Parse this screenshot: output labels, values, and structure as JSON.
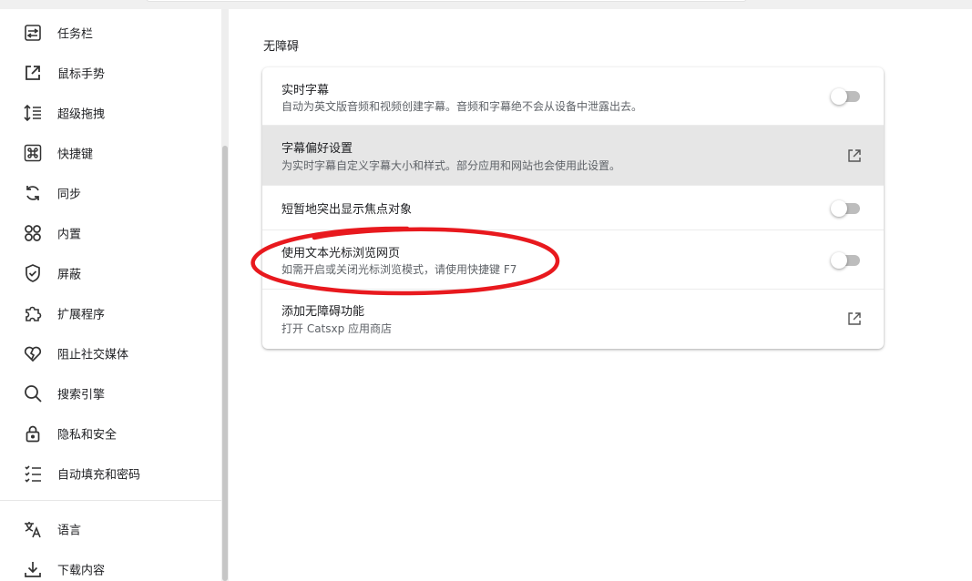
{
  "sidebar": {
    "items": [
      {
        "label": "任务栏",
        "icon": "taskbar-icon"
      },
      {
        "label": "鼠标手势",
        "icon": "external-arrow-icon"
      },
      {
        "label": "超级拖拽",
        "icon": "line-spacing-icon"
      },
      {
        "label": "快捷键",
        "icon": "command-key-icon"
      },
      {
        "label": "同步",
        "icon": "sync-icon"
      },
      {
        "label": "内置",
        "icon": "apps-icon"
      },
      {
        "label": "屏蔽",
        "icon": "shield-icon"
      },
      {
        "label": "扩展程序",
        "icon": "puzzle-icon"
      },
      {
        "label": "阻止社交媒体",
        "icon": "broken-heart-icon"
      },
      {
        "label": "搜索引擎",
        "icon": "search-icon"
      },
      {
        "label": "隐私和安全",
        "icon": "lock-icon"
      },
      {
        "label": "自动填充和密码",
        "icon": "list-icon"
      },
      {
        "label": "语言",
        "icon": "translate-icon"
      },
      {
        "label": "下载内容",
        "icon": "download-icon"
      }
    ]
  },
  "main": {
    "section_title": "无障碍",
    "rows": [
      {
        "title": "实时字幕",
        "desc": "自动为英文版音频和视频创建字幕。音频和字幕绝不会从设备中泄露出去。",
        "control": "toggle",
        "on": false
      },
      {
        "title": "字幕偏好设置",
        "desc": "为实时字幕自定义字幕大小和样式。部分应用和网站也会使用此设置。",
        "control": "external-link"
      },
      {
        "title": "短暂地突出显示焦点对象",
        "desc": "",
        "control": "toggle",
        "on": false
      },
      {
        "title": "使用文本光标浏览网页",
        "desc": "如需开启或关闭光标浏览模式，请使用快捷键 F7",
        "control": "toggle",
        "on": false
      },
      {
        "title": "添加无障碍功能",
        "desc": "打开 Catsxp 应用商店",
        "control": "external-link"
      }
    ]
  },
  "colors": {
    "annotation": "#e8191e",
    "toggle_off": "#bdbdbd",
    "hover_row": "#e6e6e6"
  }
}
